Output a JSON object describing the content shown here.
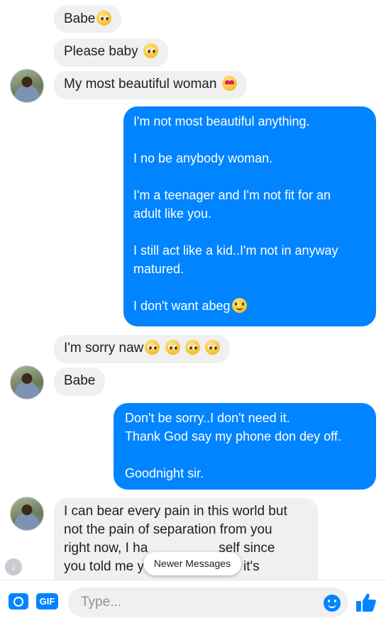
{
  "thread": {
    "messages": [
      {
        "text": "Babe",
        "emojis": [
          "pleading-face"
        ]
      },
      {
        "text": "Please baby",
        "emojis": [
          "pleading-face"
        ]
      },
      {
        "text": "My most beautiful woman",
        "emojis": [
          "heart-eyes-face"
        ]
      },
      {
        "lines": [
          "I'm not most beautiful anything.",
          "",
          "I no be anybody woman.",
          "",
          "I'm a teenager and I'm not fit for an",
          "adult like you.",
          "",
          "I still act like a kid..I'm not in anyway",
          "matured.",
          "",
          "I don't want abeg"
        ],
        "emojis": [
          "smiling-face"
        ]
      },
      {
        "text": "I'm sorry naw",
        "emojis": [
          "pleading-face",
          "pleading-face",
          "pleading-face",
          "pleading-face"
        ]
      },
      {
        "text": "Babe"
      },
      {
        "lines": [
          "Don't be sorry..I don't need it.",
          "Thank God say my phone don dey off.",
          "",
          "Goodnight sir."
        ]
      },
      {
        "line1": "I can bear every pain in this world but",
        "line2": "not the pain of separation from you",
        "line3_start": "right now, I ha",
        "line3_end": "self since",
        "line4_start": "you told me y",
        "line4_end": "it's"
      }
    ]
  },
  "newer_messages_label": "Newer Messages",
  "composer": {
    "gif_label": "GIF",
    "placeholder": "Type..."
  },
  "colors": {
    "outgoing_bubble": "#0084ff",
    "incoming_bubble": "#f1f0f0",
    "accent": "#0084ff"
  }
}
